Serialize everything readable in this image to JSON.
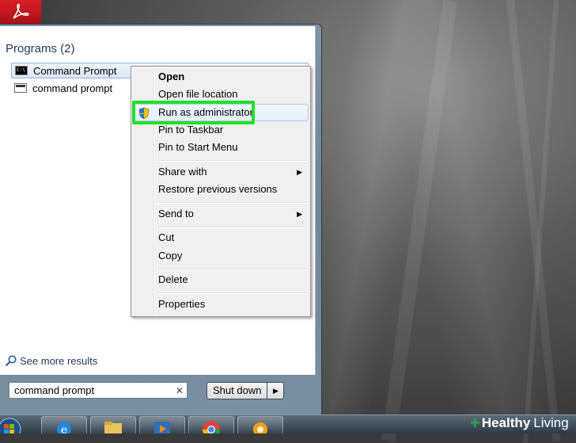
{
  "start_menu": {
    "programs_header": "Programs (2)",
    "programs": [
      {
        "label": "Command Prompt",
        "selected": true
      },
      {
        "label": "command prompt",
        "selected": false
      }
    ],
    "see_more": "See more results",
    "search": {
      "value": "command prompt",
      "clear_glyph": "✕"
    },
    "shutdown": {
      "label": "Shut down",
      "arrow": "▶"
    }
  },
  "context_menu": {
    "items": [
      {
        "label": "Open"
      },
      {
        "label": "Open file location"
      },
      {
        "label": "Run as administrator",
        "icon": "uac-shield-icon"
      },
      {
        "label": "Pin to Taskbar"
      },
      {
        "label": "Pin to Start Menu"
      },
      {
        "label": "Share with",
        "submenu": "▶"
      },
      {
        "label": "Restore previous versions"
      },
      {
        "label": "Send to",
        "submenu": "▶"
      },
      {
        "label": "Cut"
      },
      {
        "label": "Copy"
      },
      {
        "label": "Delete"
      },
      {
        "label": "Properties"
      }
    ],
    "highlight_color": "#22e02a"
  },
  "taskbar": {
    "buttons": [
      "start-orb-icon",
      "internet-explorer-icon",
      "folder-icon",
      "media-player-icon",
      "chrome-icon",
      "game-icon"
    ]
  },
  "watermark": {
    "plus": "+",
    "word1": "Healthy",
    "word2": "Living"
  },
  "desktop_icon": "acrobat-icon"
}
